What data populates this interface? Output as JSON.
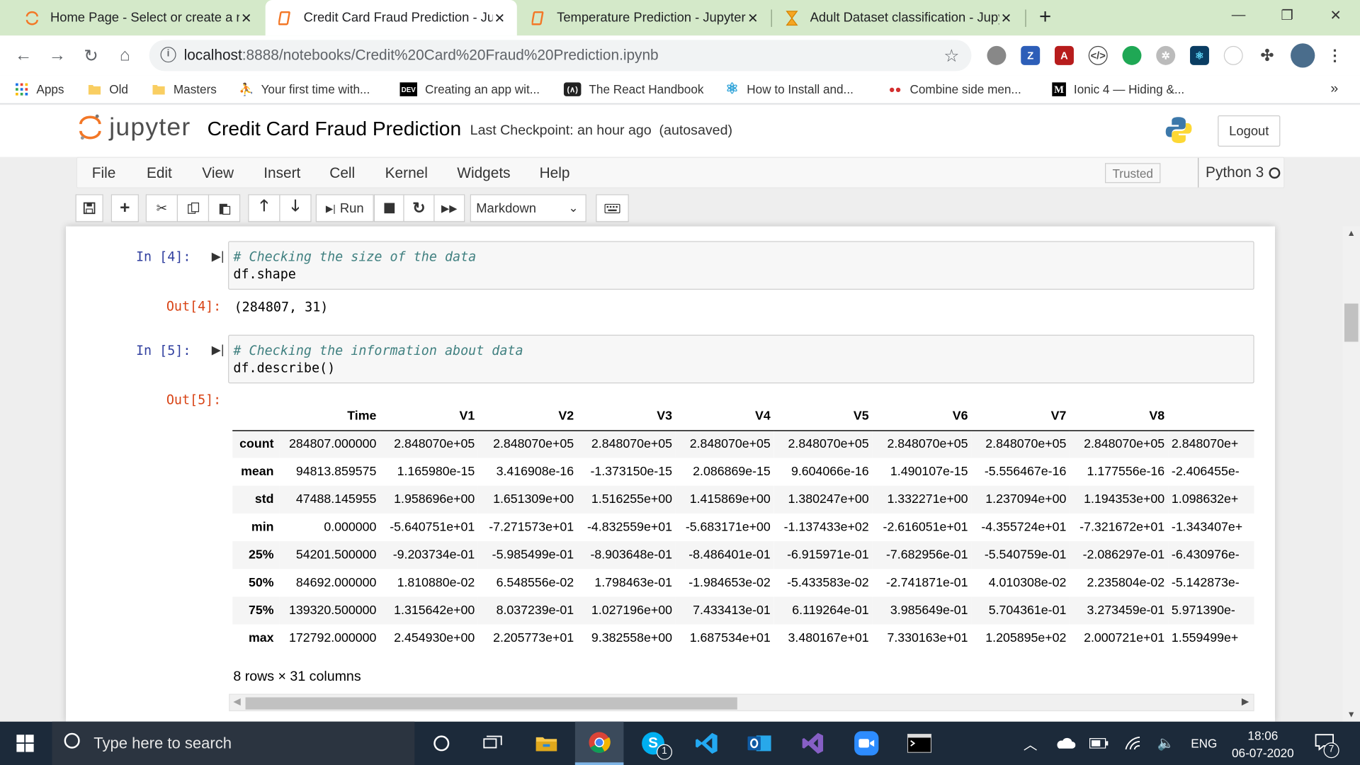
{
  "browser": {
    "tabs": [
      {
        "title": "Home Page - Select or create a n",
        "icon": "jupyter-icon",
        "active": false
      },
      {
        "title": "Credit Card Fraud Prediction - Ju",
        "icon": "notebook-icon",
        "active": true
      },
      {
        "title": "Temperature Prediction - Jupyter",
        "icon": "notebook-icon",
        "active": false
      },
      {
        "title": "Adult Dataset classification - Jupy",
        "icon": "hourglass-icon",
        "active": false
      }
    ],
    "url_host": "localhost",
    "url_path": ":8888/notebooks/Credit%20Card%20Fraud%20Prediction.ipynb",
    "bookmarks": [
      {
        "label": "Apps",
        "icon": "apps-grid-icon"
      },
      {
        "label": "Old",
        "icon": "folder-icon"
      },
      {
        "label": "Masters",
        "icon": "folder-icon"
      },
      {
        "label": "Your first time with...",
        "icon": "figure-icon"
      },
      {
        "label": "Creating an app wit...",
        "icon": "dev-icon"
      },
      {
        "label": "The React Handbook",
        "icon": "react-handbook-icon"
      },
      {
        "label": "How to Install and...",
        "icon": "react-icon"
      },
      {
        "label": "Combine side men...",
        "icon": "dots-icon"
      },
      {
        "label": "Ionic 4 — Hiding &...",
        "icon": "medium-icon"
      }
    ],
    "bookmarks_overflow": "»"
  },
  "jupyter": {
    "logo_text": "jupyter",
    "notebook_title": "Credit Card Fraud Prediction",
    "checkpoint": "Last Checkpoint: an hour ago",
    "autosaved": "(autosaved)",
    "logout_label": "Logout",
    "menus": [
      "File",
      "Edit",
      "View",
      "Insert",
      "Cell",
      "Kernel",
      "Widgets",
      "Help"
    ],
    "trusted_label": "Trusted",
    "kernel_name": "Python 3",
    "run_label": "Run",
    "cell_type": "Markdown"
  },
  "cells": [
    {
      "in_prompt": "In [4]:",
      "comment": "# Checking the size of the data",
      "code": "df.shape",
      "out_prompt": "Out[4]:",
      "output": "(284807, 31)"
    },
    {
      "in_prompt": "In [5]:",
      "comment": "# Checking the information about data",
      "code": "df.describe()",
      "out_prompt": "Out[5]:"
    }
  ],
  "describe_table": {
    "columns": [
      "Time",
      "V1",
      "V2",
      "V3",
      "V4",
      "V5",
      "V6",
      "V7",
      "V8"
    ],
    "rows": [
      {
        "label": "count",
        "values": [
          "284807.000000",
          "2.848070e+05",
          "2.848070e+05",
          "2.848070e+05",
          "2.848070e+05",
          "2.848070e+05",
          "2.848070e+05",
          "2.848070e+05",
          "2.848070e+05",
          "2.848070e+"
        ]
      },
      {
        "label": "mean",
        "values": [
          "94813.859575",
          "1.165980e-15",
          "3.416908e-16",
          "-1.373150e-15",
          "2.086869e-15",
          "9.604066e-16",
          "1.490107e-15",
          "-5.556467e-16",
          "1.177556e-16",
          "-2.406455e-"
        ]
      },
      {
        "label": "std",
        "values": [
          "47488.145955",
          "1.958696e+00",
          "1.651309e+00",
          "1.516255e+00",
          "1.415869e+00",
          "1.380247e+00",
          "1.332271e+00",
          "1.237094e+00",
          "1.194353e+00",
          "1.098632e+"
        ]
      },
      {
        "label": "min",
        "values": [
          "0.000000",
          "-5.640751e+01",
          "-7.271573e+01",
          "-4.832559e+01",
          "-5.683171e+00",
          "-1.137433e+02",
          "-2.616051e+01",
          "-4.355724e+01",
          "-7.321672e+01",
          "-1.343407e+"
        ]
      },
      {
        "label": "25%",
        "values": [
          "54201.500000",
          "-9.203734e-01",
          "-5.985499e-01",
          "-8.903648e-01",
          "-8.486401e-01",
          "-6.915971e-01",
          "-7.682956e-01",
          "-5.540759e-01",
          "-2.086297e-01",
          "-6.430976e-"
        ]
      },
      {
        "label": "50%",
        "values": [
          "84692.000000",
          "1.810880e-02",
          "6.548556e-02",
          "1.798463e-01",
          "-1.984653e-02",
          "-5.433583e-02",
          "-2.741871e-01",
          "4.010308e-02",
          "2.235804e-02",
          "-5.142873e-"
        ]
      },
      {
        "label": "75%",
        "values": [
          "139320.500000",
          "1.315642e+00",
          "8.037239e-01",
          "1.027196e+00",
          "7.433413e-01",
          "6.119264e-01",
          "3.985649e-01",
          "5.704361e-01",
          "3.273459e-01",
          "5.971390e-"
        ]
      },
      {
        "label": "max",
        "values": [
          "172792.000000",
          "2.454930e+00",
          "2.205773e+01",
          "9.382558e+00",
          "1.687534e+01",
          "3.480167e+01",
          "7.330163e+01",
          "1.205895e+02",
          "2.000721e+01",
          "1.559499e+"
        ]
      }
    ],
    "summary": "8 rows × 31 columns"
  },
  "taskbar": {
    "search_placeholder": "Type here to search",
    "language": "ENG",
    "time": "18:06",
    "date": "06-07-2020",
    "notification_count": "7",
    "skype_badge": "1"
  }
}
